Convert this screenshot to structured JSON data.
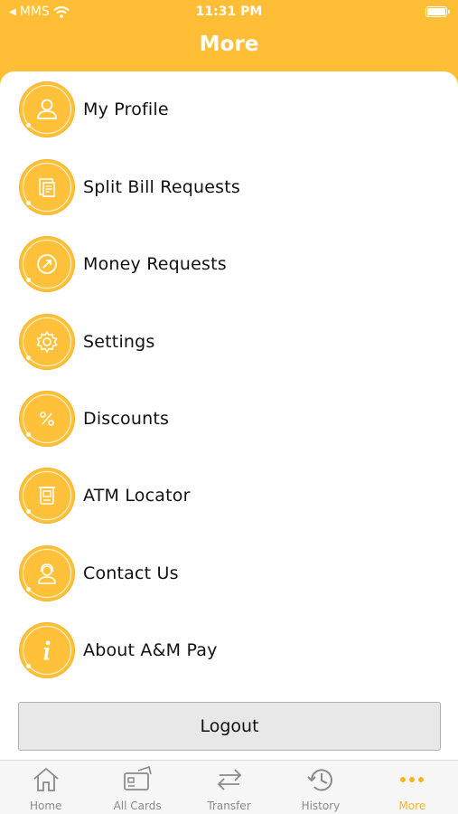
{
  "status": {
    "carrier": "MMS",
    "time": "11:31 PM"
  },
  "nav": {
    "title": "More"
  },
  "menu": [
    {
      "label": "My Profile",
      "icon": "user-icon"
    },
    {
      "label": "Split Bill Requests",
      "icon": "split-bill-icon"
    },
    {
      "label": "Money Requests",
      "icon": "money-request-icon"
    },
    {
      "label": "Settings",
      "icon": "gear-icon"
    },
    {
      "label": "Discounts",
      "icon": "percent-icon"
    },
    {
      "label": "ATM Locator",
      "icon": "atm-icon"
    },
    {
      "label": "Contact Us",
      "icon": "support-agent-icon"
    },
    {
      "label": "About A&M Pay",
      "icon": "info-icon"
    }
  ],
  "logout": {
    "label": "Logout"
  },
  "tabbar": [
    {
      "label": "Home",
      "icon": "home-icon"
    },
    {
      "label": "All Cards",
      "icon": "cards-icon"
    },
    {
      "label": "Transfer",
      "icon": "transfer-icon"
    },
    {
      "label": "History",
      "icon": "history-icon"
    },
    {
      "label": "More",
      "icon": "more-dots-icon",
      "active": true
    }
  ],
  "colors": {
    "accent": "#FFBE35",
    "active_tab": "#FFB424",
    "inactive_tab": "#8A8A8A"
  }
}
